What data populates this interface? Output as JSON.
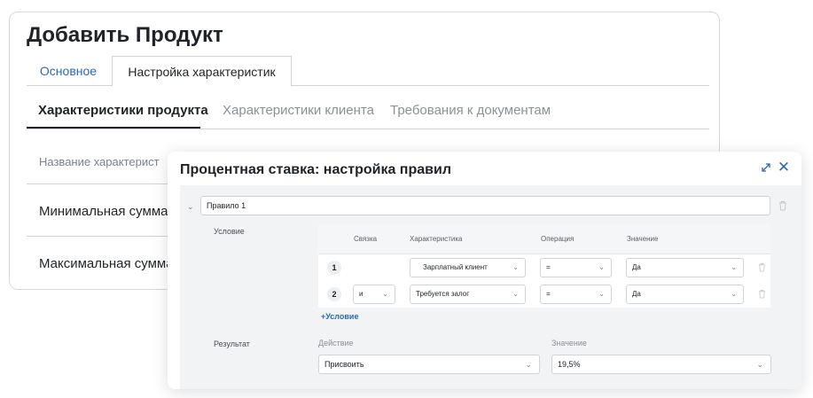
{
  "page": {
    "title": "Добавить Продукт",
    "tabs": [
      {
        "label": "Основное",
        "active": false
      },
      {
        "label": "Настройка характеристик",
        "active": true
      }
    ],
    "subtabs": [
      {
        "label": "Характеристики продукта",
        "active": true
      },
      {
        "label": "Характеристики клиента",
        "active": false
      },
      {
        "label": "Требования к документам",
        "active": false
      }
    ],
    "table": {
      "header": "Название характерист",
      "rows": [
        "Минимальная сумма",
        "Максимальная сумма"
      ]
    }
  },
  "modal": {
    "title": "Процентная ставка: настройка правил",
    "rule": {
      "name": "Правило 1",
      "condition_label": "Условие",
      "columns": [
        "Связка",
        "Характеристика",
        "Операция",
        "Значение"
      ],
      "conditions": [
        {
          "num": "1",
          "link": "",
          "characteristic": "Зарплатный клиент",
          "operation": "=",
          "value": "Да"
        },
        {
          "num": "2",
          "link": "и",
          "characteristic": "Требуется залог",
          "operation": "=",
          "value": "Да"
        }
      ],
      "add_condition": "+Условие",
      "result_label": "Результат",
      "action_label": "Действие",
      "action_value": "Присвоить",
      "value_label": "Значение",
      "value_value": "19,5%"
    }
  },
  "icons": {
    "chevron": "chevron-down-icon",
    "trash": "trash-icon",
    "expand": "expand-icon",
    "close": "close-icon"
  },
  "colors": {
    "accent": "#2a6bb0",
    "text": "#1f2328",
    "muted": "#8b9199",
    "panel": "#f2f3f5"
  }
}
